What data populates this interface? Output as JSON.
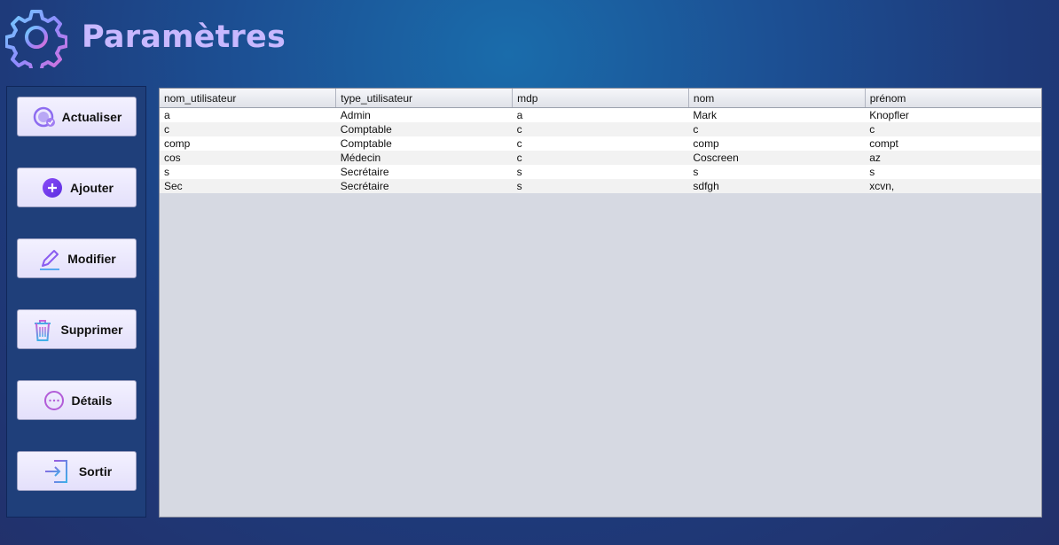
{
  "header": {
    "title": "Paramètres",
    "icon": "gear-icon",
    "accent": "#c8b8ff"
  },
  "sidebar": {
    "buttons": [
      {
        "label": "Actualiser",
        "icon": "refresh-clock-icon"
      },
      {
        "label": "Ajouter",
        "icon": "plus-circle-icon"
      },
      {
        "label": "Modifier",
        "icon": "pencil-icon"
      },
      {
        "label": "Supprimer",
        "icon": "trash-icon"
      },
      {
        "label": "Détails",
        "icon": "more-dots-icon"
      },
      {
        "label": "Sortir",
        "icon": "exit-icon"
      }
    ]
  },
  "table": {
    "columns": [
      "nom_utilisateur",
      "type_utilisateur",
      "mdp",
      "nom",
      "prénom"
    ],
    "rows": [
      [
        "a",
        "Admin",
        "a",
        "Mark",
        "Knopfler"
      ],
      [
        "c",
        "Comptable",
        "c",
        "c",
        "c"
      ],
      [
        "comp",
        "Comptable",
        "c",
        "comp",
        "compt"
      ],
      [
        "cos",
        "Médecin",
        "c",
        "Coscreen",
        "az"
      ],
      [
        "s",
        "Secrétaire",
        "s",
        "s",
        "s"
      ],
      [
        "Sec",
        "Secrétaire",
        "s",
        "sdfgh",
        "xcvn,"
      ]
    ]
  }
}
